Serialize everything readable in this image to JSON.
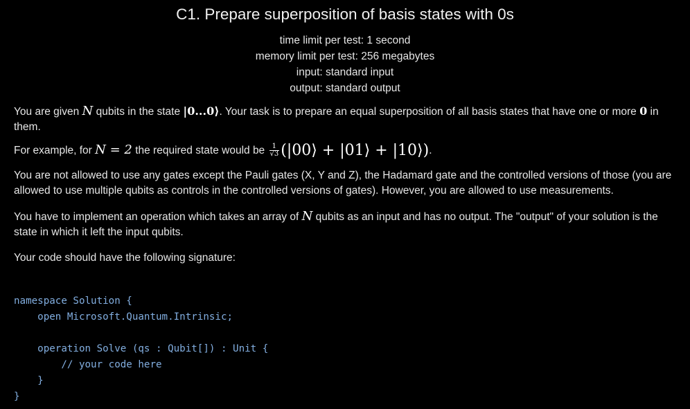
{
  "header": {
    "title": "C1. Prepare superposition of basis states with 0s",
    "time_limit": "time limit per test: 1 second",
    "memory_limit": "memory limit per test: 256 megabytes",
    "input": "input: standard input",
    "output": "output: standard output"
  },
  "p1": {
    "t1": "You are given ",
    "m_n": "N",
    "t2": " qubits in the state ",
    "m_state": "|0...0⟩",
    "t3": ". Your task is to prepare an equal superposition of all basis states that have one or more ",
    "m_zero": "0",
    "t4": " in them."
  },
  "p2": {
    "t1": "For example, for ",
    "m_eq": "N = 2",
    "t2": " the required state would be ",
    "frac_num": "1",
    "frac_den": "√3",
    "m_expr": "(|00⟩ + |01⟩ + |10⟩)",
    "t3": "."
  },
  "p3": {
    "text": "You are not allowed to use any gates except the Pauli gates (X, Y and Z), the Hadamard gate and the controlled versions of those (you are allowed to use multiple qubits as controls in the controlled versions of gates). However, you are allowed to use measurements."
  },
  "p4": {
    "t1": "You have to implement an operation which takes an array of ",
    "m_n": "N",
    "t2": " qubits as an input and has no output. The \"output\" of your solution is the state in which it left the input qubits."
  },
  "p5": {
    "text": "Your code should have the following signature:"
  },
  "code": {
    "text": "namespace Solution {\n    open Microsoft.Quantum.Intrinsic;\n\n    operation Solve (qs : Qubit[]) : Unit {\n        // your code here\n    }\n}"
  }
}
